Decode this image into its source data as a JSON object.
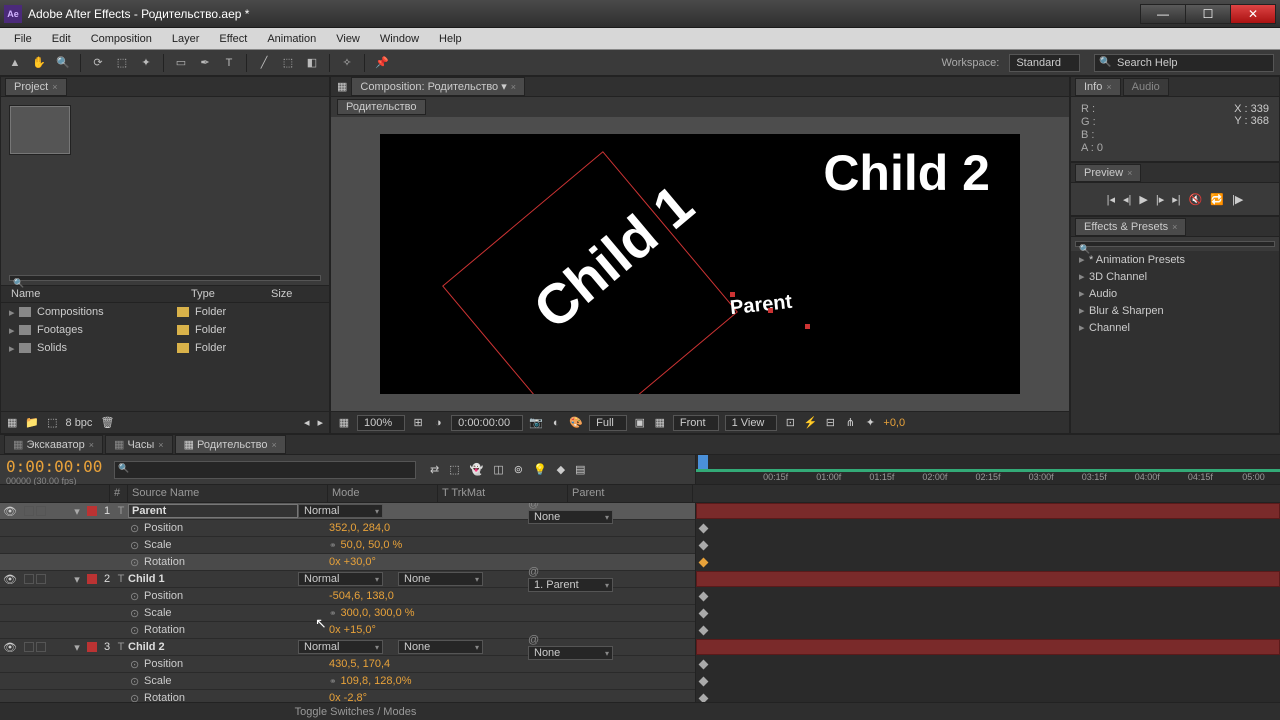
{
  "app": {
    "title": "Adobe After Effects - Родительство.aep *",
    "icon": "Ae"
  },
  "window_buttons": {
    "min": "—",
    "max": "☐",
    "close": "✕"
  },
  "menu": [
    "File",
    "Edit",
    "Composition",
    "Layer",
    "Effect",
    "Animation",
    "View",
    "Window",
    "Help"
  ],
  "workspace": {
    "label": "Workspace:",
    "value": "Standard"
  },
  "search_help": {
    "placeholder": "Search Help"
  },
  "project_panel": {
    "tab": "Project",
    "columns": {
      "name": "Name",
      "type": "Type",
      "size": "Size"
    },
    "items": [
      {
        "name": "Compositions",
        "type": "Folder",
        "cls": "g"
      },
      {
        "name": "Footages",
        "type": "Folder",
        "cls": "y"
      },
      {
        "name": "Solids",
        "type": "Folder",
        "cls": "y"
      }
    ],
    "bpc": "8 bpc"
  },
  "viewer": {
    "tab_prefix": "Composition:",
    "comp_name": "Родительство",
    "subtab": "Родительство",
    "child1": "Child 1",
    "child2": "Child 2",
    "parent": "Parent",
    "zoom": "100%",
    "time": "0:00:00:00",
    "res": "Full",
    "camera": "Front",
    "views": "1 View",
    "exposure": "+0,0"
  },
  "info": {
    "tab": "Info",
    "tab2": "Audio",
    "r": "R :",
    "g": "G :",
    "b": "B :",
    "a": "A : 0",
    "x": "X : 339",
    "y": "Y : 368"
  },
  "preview": {
    "tab": "Preview"
  },
  "effects": {
    "tab": "Effects & Presets",
    "items": [
      "* Animation Presets",
      "3D Channel",
      "Audio",
      "Blur & Sharpen",
      "Channel"
    ]
  },
  "timeline": {
    "tabs": [
      "Экскаватор",
      "Часы",
      "Родительство"
    ],
    "time": "0:00:00:00",
    "fps": "00000 (30.00 fps)",
    "ruler": [
      "",
      "00:15f",
      "01:00f",
      "01:15f",
      "02:00f",
      "02:15f",
      "03:00f",
      "03:15f",
      "04:00f",
      "04:15f",
      "05:00"
    ],
    "head": {
      "num": "#",
      "source": "Source Name",
      "mode": "Mode",
      "trk": "T   TrkMat",
      "parent": "Parent"
    },
    "layers": [
      {
        "num": "1",
        "name": "Parent",
        "selected": true,
        "mode": "Normal",
        "trk": "",
        "parent": "None",
        "props": [
          {
            "name": "Position",
            "value": "352,0, 284,0"
          },
          {
            "name": "Scale",
            "value": "50,0, 50,0 %",
            "link": true
          },
          {
            "name": "Rotation",
            "value": "0x +30,0°",
            "sel": true
          }
        ]
      },
      {
        "num": "2",
        "name": "Child 1",
        "mode": "Normal",
        "trk": "None",
        "parent": "1. Parent",
        "props": [
          {
            "name": "Position",
            "value": "-504,6, 138,0"
          },
          {
            "name": "Scale",
            "value": "300,0, 300,0 %",
            "link": true
          },
          {
            "name": "Rotation",
            "value": "0x +15,0°"
          }
        ]
      },
      {
        "num": "3",
        "name": "Child 2",
        "mode": "Normal",
        "trk": "None",
        "parent": "None",
        "props": [
          {
            "name": "Position",
            "value": "430,5, 170,4"
          },
          {
            "name": "Scale",
            "value": "109,8, 128,0%",
            "link": true
          },
          {
            "name": "Rotation",
            "value": "0x -2,8°"
          }
        ]
      }
    ],
    "toggle": "Toggle Switches / Modes"
  }
}
